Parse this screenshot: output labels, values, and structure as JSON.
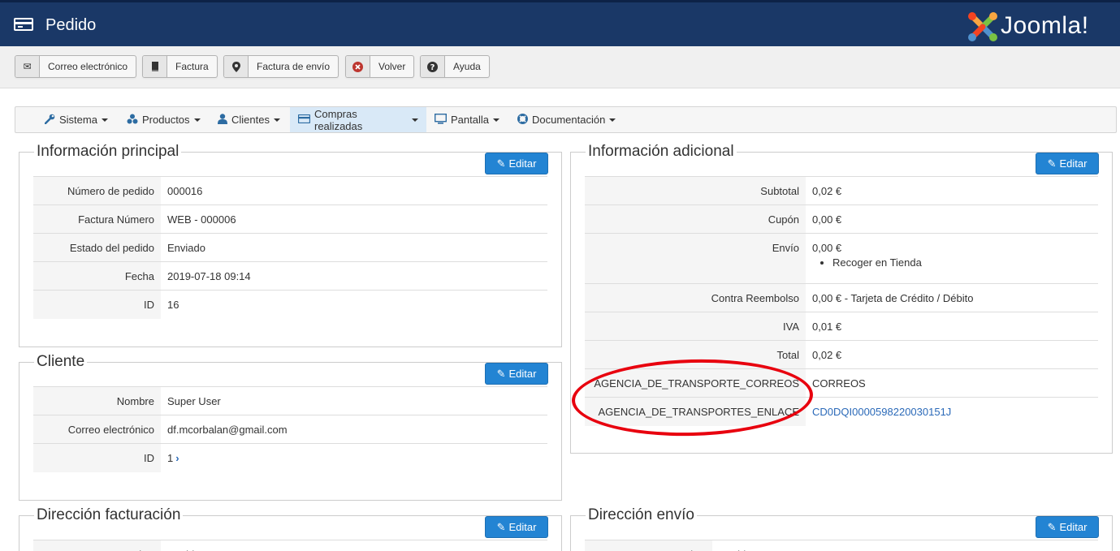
{
  "header": {
    "title": "Pedido",
    "brand": "Joomla!"
  },
  "toolbar": {
    "buttons": [
      {
        "label": "Correo electrónico",
        "icon": "envelope-icon"
      },
      {
        "label": "Factura",
        "icon": "book-icon"
      },
      {
        "label": "Factura de envío",
        "icon": "map-marker-icon"
      },
      {
        "label": "Volver",
        "icon": "cancel-circle-icon"
      },
      {
        "label": "Ayuda",
        "icon": "question-circle-icon"
      }
    ]
  },
  "nav": {
    "items": [
      {
        "label": "Sistema",
        "icon": "wrench-icon"
      },
      {
        "label": "Productos",
        "icon": "cubes-icon"
      },
      {
        "label": "Clientes",
        "icon": "user-icon"
      },
      {
        "label": "Compras realizadas",
        "icon": "credit-card-icon",
        "active": true
      },
      {
        "label": "Pantalla",
        "icon": "monitor-icon"
      },
      {
        "label": "Documentación",
        "icon": "life-ring-icon"
      }
    ]
  },
  "edit_label": "Editar",
  "main_info": {
    "legend": "Información principal",
    "rows": [
      {
        "key": "Número de pedido",
        "value": "000016"
      },
      {
        "key": "Factura Número",
        "value": "WEB - 000006"
      },
      {
        "key": "Estado del pedido",
        "value": "Enviado"
      },
      {
        "key": "Fecha",
        "value": "2019-07-18 09:14"
      },
      {
        "key": "ID",
        "value": "16"
      }
    ]
  },
  "client": {
    "legend": "Cliente",
    "rows": [
      {
        "key": "Nombre",
        "value": "Super User"
      },
      {
        "key": "Correo electrónico",
        "value": "df.mcorbalan@gmail.com"
      },
      {
        "key": "ID",
        "value": "1"
      }
    ]
  },
  "extra_info": {
    "legend": "Información adicional",
    "rows": [
      {
        "key": "Subtotal",
        "value": "0,02 €"
      },
      {
        "key": "Cupón",
        "value": "0,00 €"
      },
      {
        "key": "Envío",
        "value": "0,00 €",
        "bullet": "Recoger en Tienda"
      },
      {
        "key": "Contra Reembolso",
        "value": "0,00 € - Tarjeta de Crédito / Débito"
      },
      {
        "key": "IVA",
        "value": "0,01 €"
      },
      {
        "key": "Total",
        "value": "0,02 €"
      },
      {
        "key": "AGENCIA_DE_TRANSPORTE_CORREOS",
        "value": "CORREOS"
      },
      {
        "key": "AGENCIA_DE_TRANSPORTES_ENLACE",
        "value": "CD0DQI0000598220030151J"
      }
    ]
  },
  "billing": {
    "legend": "Dirección facturación",
    "first_key": "Nombre",
    "first_value": "David"
  },
  "shipping": {
    "legend": "Dirección envío",
    "first_key": "Nombre",
    "first_value": "David"
  },
  "colors": {
    "header": "#1a3867",
    "edit_button": "#2384d3",
    "active_nav": "#d9e9f7",
    "annotation": "#e8000e"
  }
}
